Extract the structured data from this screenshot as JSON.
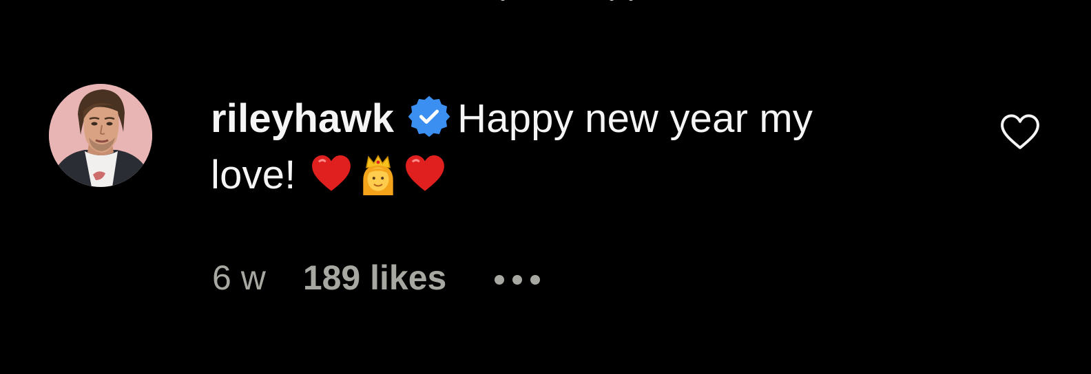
{
  "comment": {
    "username": "rileyhawk",
    "verified_icon": "verified-badge-icon",
    "text_line1": "Happy new year my",
    "text_line2": "love!",
    "emojis": [
      "red-heart-emoji",
      "princess-emoji",
      "red-heart-emoji"
    ],
    "time": "6 w",
    "likes": "189 likes",
    "more_icon": "ellipsis-icon",
    "like_icon": "heart-outline-icon",
    "avatar": "profile-photo"
  },
  "colors": {
    "background": "#000000",
    "text": "#f5f5f5",
    "meta": "#a8a8a2",
    "verified": "#3b8ff0",
    "heart": "#e0201f",
    "avatar_bg": "#e8b5b4"
  }
}
